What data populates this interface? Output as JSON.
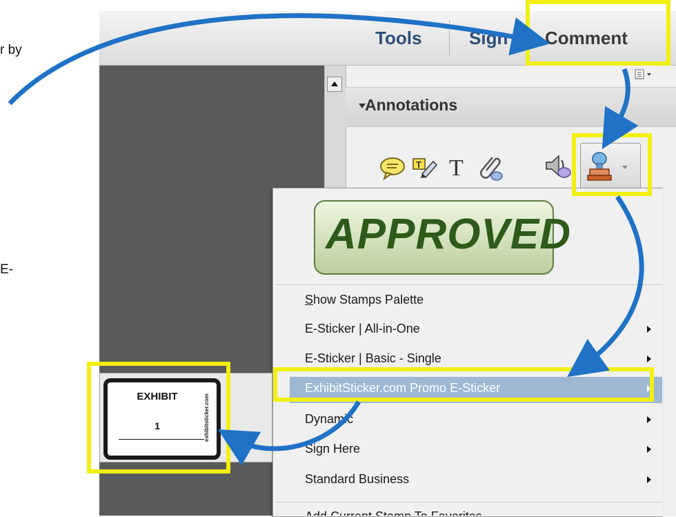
{
  "left_text": {
    "fragment_1": "r by",
    "fragment_2": "E-"
  },
  "toolbar": {
    "tools_label": "Tools",
    "sign_label": "Sign",
    "comment_label": "Comment"
  },
  "panel": {
    "options_icon": "panel-options-icon",
    "annotations_title": "Annotations",
    "tools": [
      {
        "name": "sticky-note-icon"
      },
      {
        "name": "highlight-text-icon"
      },
      {
        "name": "add-text-icon"
      },
      {
        "name": "attach-file-icon"
      },
      {
        "name": "record-audio-icon"
      },
      {
        "name": "stamp-icon"
      }
    ]
  },
  "menu": {
    "stamp_preview_text": "APPROVED",
    "items": [
      {
        "label": "Show Stamps Palette",
        "submenu": false
      },
      {
        "label": "E-Sticker | All-in-One",
        "submenu": true
      },
      {
        "label": "E-Sticker | Basic - Single",
        "submenu": true
      },
      {
        "label": "ExhibitSticker.com Promo E-Sticker",
        "submenu": true,
        "highlighted": true
      },
      {
        "label": "Dynamic",
        "submenu": true
      },
      {
        "label": "Sign Here",
        "submenu": true
      },
      {
        "label": "Standard Business",
        "submenu": true
      },
      {
        "label": "Add Current Stamp To Favorites",
        "submenu": false
      }
    ]
  },
  "submenu": {
    "exhibit_label": "EXHIBIT",
    "exhibit_number": "1",
    "exhibit_site": "exhibitsticker.com"
  },
  "colors": {
    "highlight": "#f2ef12",
    "arrow": "#1f72c6",
    "menu_selected": "#9eb8d4",
    "toolbar_text": "#2e4f7a"
  }
}
